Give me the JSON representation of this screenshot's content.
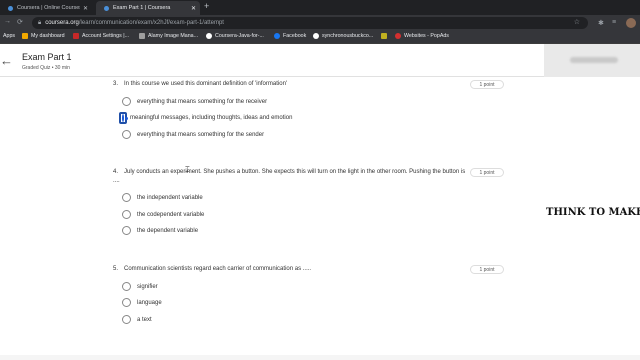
{
  "browser": {
    "tabs": [
      {
        "label": "Coursera | Online Courses & Cre",
        "active": false
      },
      {
        "label": "Exam Part 1 | Coursera",
        "active": true
      }
    ],
    "url_host": "coursera.org",
    "url_path": "/learn/communication/exam/x2hJf/exam-part-1/attempt",
    "bookmarks": [
      {
        "label": "Apps",
        "color": "#5f6368"
      },
      {
        "label": "My dashboard",
        "color": "#f2a900"
      },
      {
        "label": "Account Settings |...",
        "color": "#c62828"
      },
      {
        "label": "Alamy Image Mana...",
        "color": "#9e9e9e"
      },
      {
        "label": "Coursera-Java-for-...",
        "color": "#ffffff"
      },
      {
        "label": "Facebook",
        "color": "#1877f2"
      },
      {
        "label": "synchronousbuckco...",
        "color": "#ffffff"
      },
      {
        "label": "",
        "color": "#c0b020"
      },
      {
        "label": "Websites - PopAds",
        "color": "#d32f2f"
      }
    ]
  },
  "header": {
    "title": "Exam Part 1",
    "subtitle": "Graded Quiz • 30 min"
  },
  "questions": [
    {
      "number": "3.",
      "text": "In this course we used this dominant definition of 'information'",
      "points": "1 point",
      "options": [
        {
          "label": "everything that means something for the receiver",
          "selected": false
        },
        {
          "label": "meaningful messages, including thoughts, ideas and emotion",
          "selected": true
        },
        {
          "label": "everything that means something for the sender",
          "selected": false
        }
      ]
    },
    {
      "number": "4.",
      "text": "July conducts an experiment. She pushes a button. She expects this will turn on the light in the other room. Pushing the button is ....",
      "points": "1 point",
      "options": [
        {
          "label": "the independent variable",
          "selected": false
        },
        {
          "label": "the codependent variable",
          "selected": false
        },
        {
          "label": "the dependent variable",
          "selected": false
        }
      ]
    },
    {
      "number": "5.",
      "text": "Communication scientists regard each carrier of communication as .....",
      "points": "1 point",
      "options": [
        {
          "label": "signifier",
          "selected": false
        },
        {
          "label": "language",
          "selected": false
        },
        {
          "label": "a text",
          "selected": false
        }
      ]
    }
  ],
  "side_text": "THINK TO MAKE",
  "colors": {
    "accent": "#1a58d6",
    "chrome_dark": "#202124",
    "chrome": "#35363a"
  }
}
